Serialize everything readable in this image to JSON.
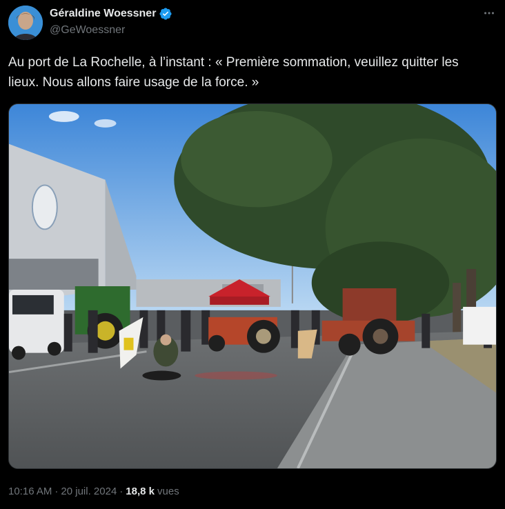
{
  "author": {
    "display_name": "Géraldine Woessner",
    "handle": "@GeWoessner",
    "verified": true
  },
  "tweet": {
    "text": "Au port de La Rochelle, à l’instant : « Première sommation, veuillez quitter les lieux. Nous allons faire usage de la force. »"
  },
  "meta": {
    "time": "10:16 AM",
    "separator": "·",
    "date": "20 juil. 2024",
    "views_count": "18,8 k",
    "views_label": "vues"
  },
  "colors": {
    "background": "#000000",
    "text": "#e7e9ea",
    "secondary": "#71767b",
    "verified_blue": "#1d9bf0"
  },
  "icons": {
    "verified": "verified-badge-icon",
    "more": "more-horizontal-icon"
  }
}
